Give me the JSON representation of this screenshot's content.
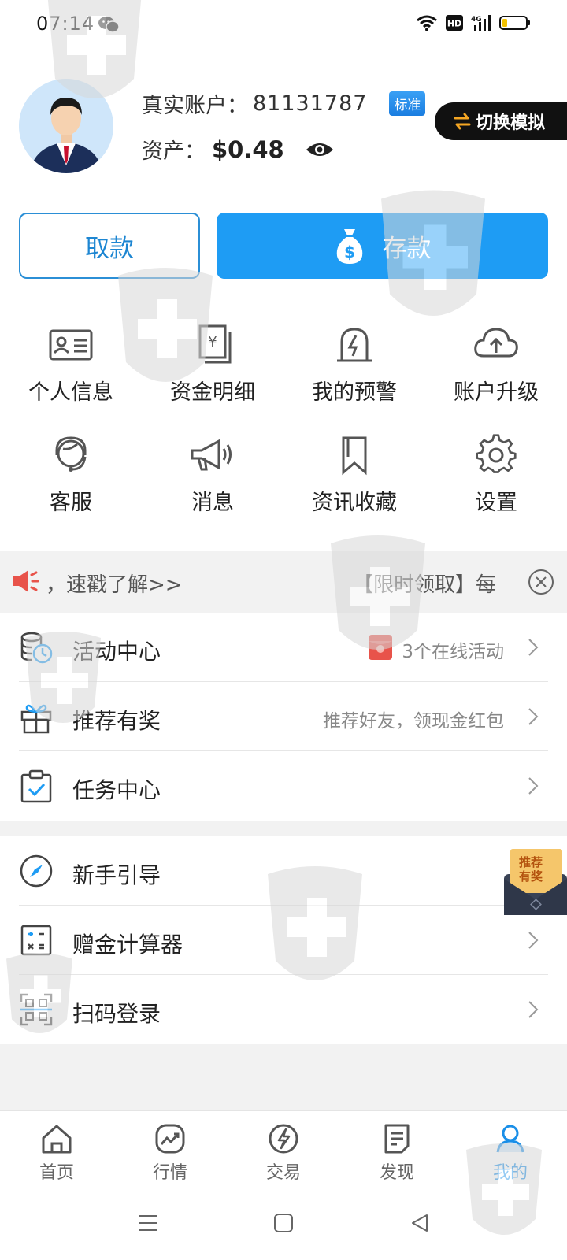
{
  "status": {
    "time": "07:14",
    "icons": [
      "wechat-icon",
      "wifi-icon",
      "hd-icon",
      "signal-4g-icon",
      "battery-icon"
    ],
    "network": "4G"
  },
  "profile": {
    "account_label": "真实账户：",
    "account_number": "81131787",
    "account_badge": "标准",
    "asset_label": "资产：",
    "asset_value": "$0.48",
    "switch_label": "切换模拟"
  },
  "actions": {
    "withdraw": "取款",
    "deposit": "存款"
  },
  "grid": [
    {
      "label": "个人信息",
      "icon": "id-card-icon"
    },
    {
      "label": "资金明细",
      "icon": "funds-detail-icon"
    },
    {
      "label": "我的预警",
      "icon": "alert-icon"
    },
    {
      "label": "账户升级",
      "icon": "cloud-upload-icon"
    },
    {
      "label": "客服",
      "icon": "customer-service-icon"
    },
    {
      "label": "消息",
      "icon": "megaphone-icon"
    },
    {
      "label": "资讯收藏",
      "icon": "bookmark-icon"
    },
    {
      "label": "设置",
      "icon": "gear-icon"
    }
  ],
  "marquee": {
    "left_text": "，速戳了解>>",
    "right_text": "【限时领取】每"
  },
  "list1": [
    {
      "label": "活动中心",
      "right": "3个在线活动",
      "icon": "activity-icon"
    },
    {
      "label": "推荐有奖",
      "right": "推荐好友，领现金红包",
      "icon": "gift-icon"
    },
    {
      "label": "任务中心",
      "right": "",
      "icon": "task-icon"
    }
  ],
  "list2": [
    {
      "label": "新手引导",
      "icon": "compass-icon"
    },
    {
      "label": "赠金计算器",
      "icon": "calculator-icon"
    },
    {
      "label": "扫码登录",
      "icon": "qr-scan-icon"
    }
  ],
  "float_badge": {
    "line1": "推荐",
    "line2": "有奖"
  },
  "nav": [
    {
      "label": "首页",
      "icon": "home-icon"
    },
    {
      "label": "行情",
      "icon": "market-icon"
    },
    {
      "label": "交易",
      "icon": "trade-icon"
    },
    {
      "label": "发现",
      "icon": "discover-icon"
    },
    {
      "label": "我的",
      "icon": "profile-icon",
      "active": true
    }
  ],
  "colors": {
    "primary": "#1e9cf4",
    "active_nav": "#1a8fe8",
    "badge_dark": "#111111"
  }
}
